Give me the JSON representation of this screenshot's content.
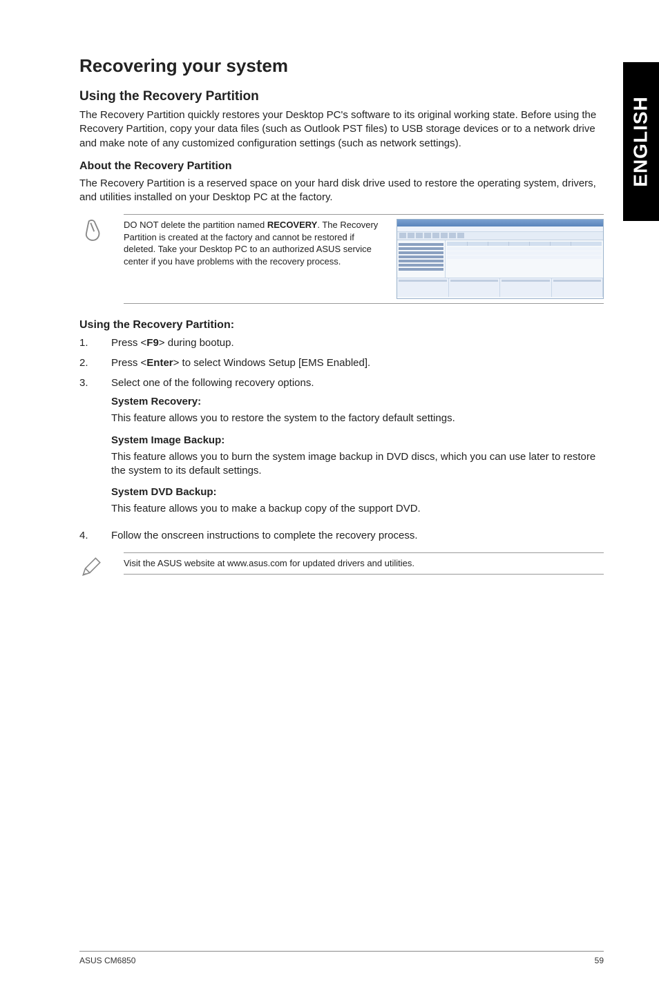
{
  "side_tab": "ENGLISH",
  "h1": "Recovering your system",
  "h2_1": "Using the Recovery Partition",
  "p1": "The Recovery Partition quickly restores your Desktop PC's software to its original working state. Before using the Recovery Partition, copy your data files (such as Outlook PST files) to USB storage devices or to a network drive and make note of any customized configuration settings (such as network settings).",
  "h3_about": "About the Recovery Partition",
  "p_about": "The Recovery Partition is a reserved space on your hard disk drive used to restore the operating system, drivers, and utilities installed on your Desktop PC at the factory.",
  "note1_pre": "DO NOT delete the partition named ",
  "note1_bold": "RECOVERY",
  "note1_post": ". The Recovery Partition is created at the factory and cannot be restored if deleted. Take your Desktop PC to an authorized ASUS service center if you have problems with the recovery process.",
  "h3_using": "Using the Recovery Partition:",
  "step1_num": "1.",
  "step1_a": "Press <",
  "step1_b": "F9",
  "step1_c": "> during bootup.",
  "step2_num": "2.",
  "step2_a": "Press <",
  "step2_b": "Enter",
  "step2_c": "> to select Windows Setup [EMS Enabled].",
  "step3_num": "3.",
  "step3": "Select one of the following recovery options.",
  "sr_h": "System Recovery:",
  "sr_p": "This feature allows you to restore the system to the factory default settings.",
  "sib_h": "System Image Backup:",
  "sib_p": "This feature allows you to burn the system image backup in DVD discs, which you can use later to restore the system to its default settings.",
  "sdb_h": "System DVD Backup:",
  "sdb_p": "This feature allows you to make a backup copy of the support DVD.",
  "step4_num": "4.",
  "step4": "Follow the onscreen instructions to complete the recovery process.",
  "note2": "Visit the ASUS website at www.asus.com for updated drivers and utilities.",
  "footer_left": "ASUS CM6850",
  "footer_right": "59"
}
